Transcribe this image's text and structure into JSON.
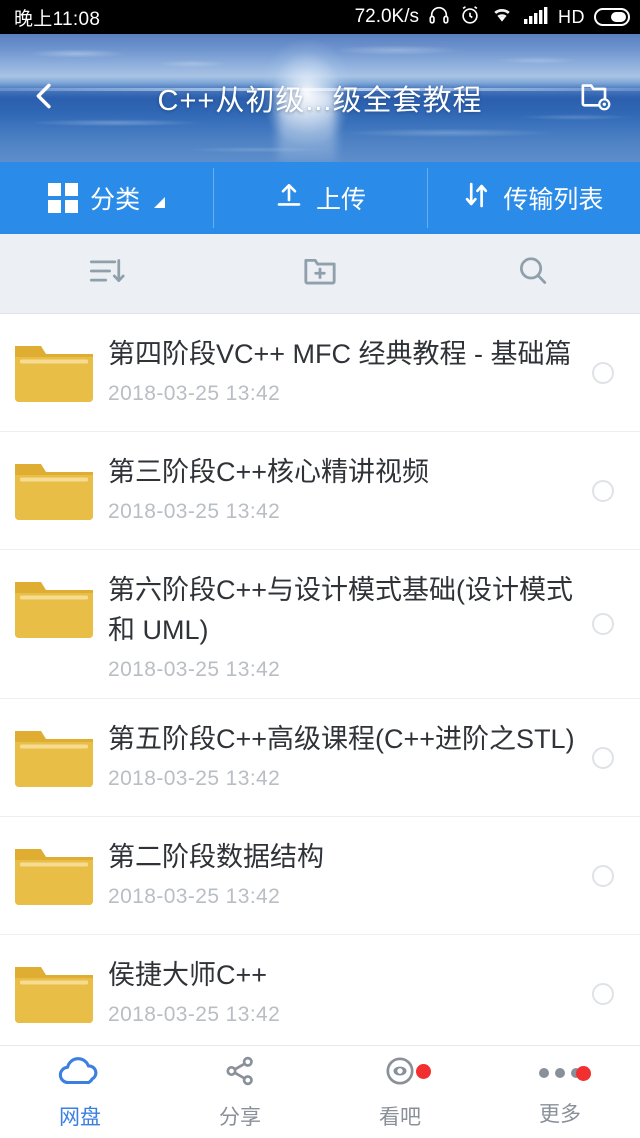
{
  "status_bar": {
    "clock": "晚上11:08",
    "net_speed": "72.0K/s",
    "hd_label": "HD",
    "icons": [
      "headset-icon",
      "alarm-clock-icon",
      "wifi-icon",
      "signal-bars-icon",
      "battery-icon"
    ]
  },
  "header": {
    "title": "C++从初级...级全套教程",
    "back_icon": "back-chevron-icon",
    "folder_settings_icon": "folder-settings-icon"
  },
  "action_bar": {
    "items": [
      {
        "label": "分类",
        "icon": "grid-icon",
        "has_caret": true
      },
      {
        "label": "上传",
        "icon": "upload-icon",
        "has_caret": false
      },
      {
        "label": "传输列表",
        "icon": "transfer-icon",
        "has_caret": false
      }
    ]
  },
  "tool_strip": {
    "items": [
      {
        "icon": "sort-icon",
        "name": "sort-button"
      },
      {
        "icon": "new-folder-icon",
        "name": "new-folder-button"
      },
      {
        "icon": "search-icon",
        "name": "search-button"
      }
    ]
  },
  "file_list": {
    "rows": [
      {
        "name": "第四阶段VC++ MFC 经典教程 - 基础篇",
        "date": "2018-03-25  13:42",
        "type": "folder",
        "selected": false
      },
      {
        "name": "第三阶段C++核心精讲视频",
        "date": "2018-03-25  13:42",
        "type": "folder",
        "selected": false
      },
      {
        "name": "第六阶段C++与设计模式基础(设计模式和 UML)",
        "date": "2018-03-25  13:42",
        "type": "folder",
        "selected": false
      },
      {
        "name": "第五阶段C++高级课程(C++进阶之STL)",
        "date": "2018-03-25  13:42",
        "type": "folder",
        "selected": false
      },
      {
        "name": "第二阶段数据结构",
        "date": "2018-03-25  13:42",
        "type": "folder",
        "selected": false
      },
      {
        "name": "侯捷大师C++",
        "date": "2018-03-25  13:42",
        "type": "folder",
        "selected": false
      }
    ]
  },
  "bottom_nav": {
    "items": [
      {
        "label": "网盘",
        "icon": "cloud-icon",
        "active": true,
        "badge": false
      },
      {
        "label": "分享",
        "icon": "share-icon",
        "active": false,
        "badge": false
      },
      {
        "label": "看吧",
        "icon": "eye-icon",
        "active": false,
        "badge": true
      },
      {
        "label": "更多",
        "icon": "more-icon",
        "active": false,
        "badge": true
      }
    ]
  },
  "colors": {
    "accent_blue": "#2b8be8",
    "nav_active": "#3b7fe0",
    "folder_yellow": "#e5b73b",
    "badge_red": "#f23030",
    "toolstrip_bg": "#eceff4",
    "text_primary": "#2f3338",
    "text_muted": "#b9bec4"
  }
}
